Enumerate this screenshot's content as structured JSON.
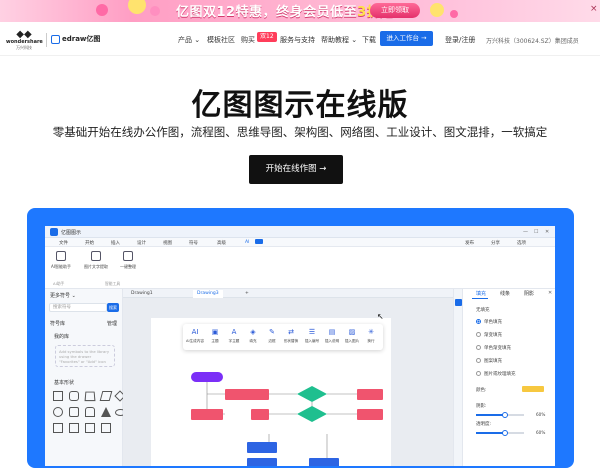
{
  "banner": {
    "title_a": "亿图双12特惠，终身会员低至",
    "title_hl": "3折起",
    "button": "立即领取",
    "close": "×"
  },
  "nav": {
    "brand_main": "wondershare",
    "brand_sub": "万兴科技",
    "product": "edraw亿图",
    "items": [
      "产品",
      "模板社区",
      "购买",
      "服务与支持",
      "帮助教程",
      "下载"
    ],
    "badge": "双12",
    "cta": "进入工作台 →",
    "login": "登录/注册",
    "corp": "万兴科技（300624.SZ）集团成员"
  },
  "hero": {
    "title": "亿图图示在线版",
    "subtitle": "零基础开始在线办公作图，流程图、思维导图、架构图、网络图、工业设计、图文混排，一软搞定",
    "button": "开始在线作图 →"
  },
  "app": {
    "title": "亿图图示",
    "menu": [
      "文件",
      "开始",
      "插入",
      "设计",
      "视图",
      "符号",
      "高级",
      "AI"
    ],
    "menu_right": [
      "发布",
      "分享",
      "选项"
    ],
    "ribbon": [
      {
        "label": "AI智能助手"
      },
      {
        "label": "图片文字提取"
      },
      {
        "label": "一键整理"
      }
    ],
    "ribbon_groups": [
      "AI助手",
      "智能工具"
    ],
    "tabs": [
      "Drawing1",
      "Drawing3"
    ],
    "left": {
      "header": "更多符号",
      "search_placeholder": "搜索符号",
      "search_btn": "搜索",
      "lib": "符号库",
      "manage": "管理",
      "my": "我的库",
      "note": "Add symbols to the library using the drawer \"Favorites\" or \"Add\" icon",
      "basic": "基本形状"
    },
    "toolbar": [
      "AI生成内容",
      "主题",
      "字主题",
      "填充",
      "边框",
      "形状替换",
      "插入编号",
      "插入说明",
      "插入图片",
      "换行"
    ],
    "right": {
      "tabs": [
        "填充",
        "线条",
        "阴影"
      ],
      "section": "无填充",
      "options": [
        "单色填充",
        "渐变填充",
        "单色渐变填充",
        "图案填充",
        "图片或纹理填充"
      ],
      "color_label": "颜色:",
      "shade_label": "阴影:",
      "alpha_label": "透明度:",
      "shade_value": "60%",
      "alpha_value": "60%",
      "shade_fraction": 0.6,
      "alpha_fraction": 0.6,
      "fill_color": "#f7c840"
    }
  }
}
